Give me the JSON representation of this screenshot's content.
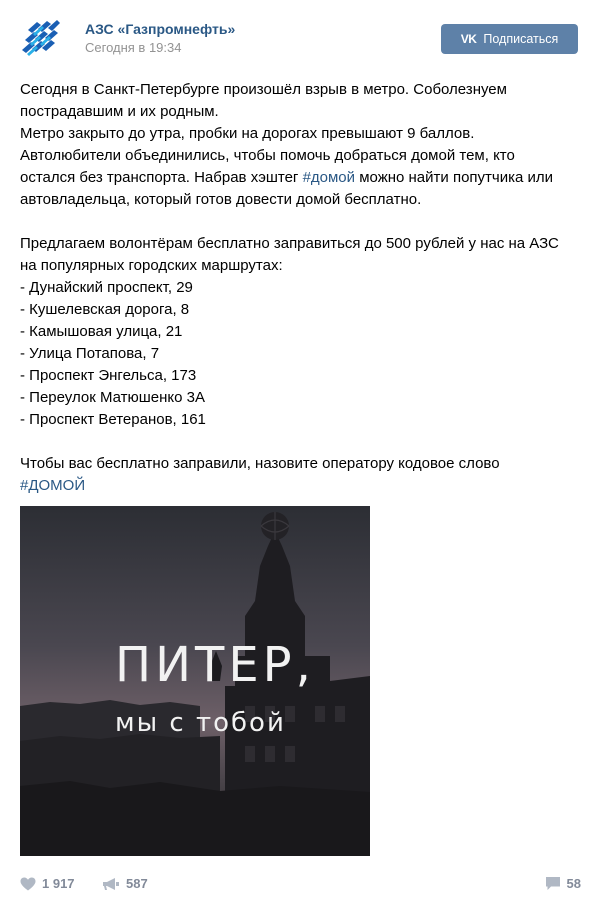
{
  "post": {
    "author": "АЗС «Газпромнефть»",
    "date": "Сегодня в 19:34",
    "subscribe_label": "Подписаться",
    "subscribe_logo": "VK",
    "text": {
      "line1a": "Сегодня в Санкт-Петербурге произошёл взрыв в метро. Соболезнуем",
      "line1b": "пострадавшим и их родным.",
      "line2": "Метро закрыто до утра, пробки на дорогах превышают 9 баллов.",
      "line3a": "Автолюбители объединились, чтобы помочь добраться домой тем, кто",
      "line3b_pre": "остался без транспорта. Набрав хэштег ",
      "hashtag1": "#домой",
      "line3b_post": " можно найти попутчика или",
      "line3c": "автовладельца, который готов довести домой бесплатно.",
      "offer_a": "Предлагаем волонтёрам бесплатно заправиться до 500 рублей у нас на АЗС",
      "offer_b": "на популярных городских маршрутах:",
      "routes": [
        "- Дунайский проспект, 29",
        "- Кушелевская дорога, 8",
        "- Камышовая улица, 21",
        "- Улица Потапова, 7",
        "- Проспект Энгельса, 173",
        "- Переулок Матюшенко 3А",
        "- Проспект Ветеранов, 161"
      ],
      "closing": "Чтобы вас бесплатно заправили, назовите оператору кодовое слово",
      "hashtag2": "#ДОМОЙ"
    },
    "image": {
      "caption_line1": "ПИТЕР,",
      "caption_line2": "мы с тобой"
    },
    "stats": {
      "likes": "1 917",
      "shares": "587",
      "comments": "58"
    }
  },
  "colors": {
    "link": "#2a5885",
    "button": "#5e81a8",
    "muted": "#939393",
    "action": "#828a99"
  }
}
